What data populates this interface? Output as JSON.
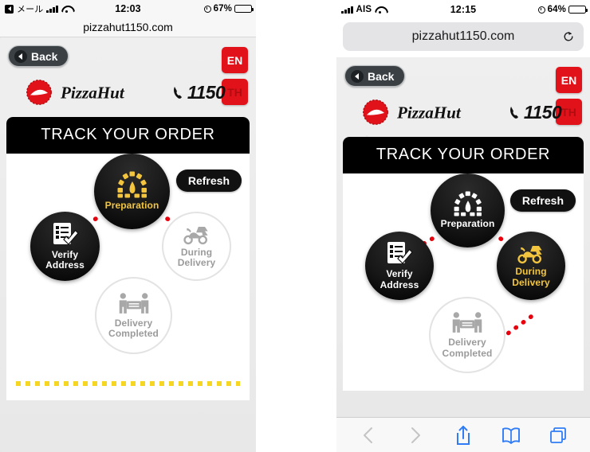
{
  "left_phone": {
    "status_bar": {
      "back_app": "メール",
      "carrier": "",
      "time": "12:03",
      "battery_pct": "67%",
      "signal_icon": "signal-bars-icon",
      "wifi_icon": "wifi-icon",
      "alarm_icon": "alarm-clock-icon",
      "battery_icon": "battery-icon"
    },
    "url": "pizzahut1150.com",
    "back_label": "Back",
    "lang_en": "EN",
    "lang_th": "TH",
    "brand_name": "PizzaHut",
    "phone_number": "1150",
    "track_title": "TRACK YOUR ORDER",
    "refresh_label": "Refresh",
    "steps": [
      {
        "id": "preparation",
        "label_line1": "Preparation",
        "label_line2": "",
        "state": "active-gold",
        "icon": "pizza-oven-icon"
      },
      {
        "id": "verify-address",
        "label_line1": "Verify",
        "label_line2": "Address",
        "state": "active-white",
        "icon": "checklist-icon"
      },
      {
        "id": "during-delivery",
        "label_line1": "During",
        "label_line2": "Delivery",
        "state": "idle",
        "icon": "scooter-icon"
      },
      {
        "id": "delivery-completed",
        "label_line1": "Delivery",
        "label_line2": "Completed",
        "state": "idle",
        "icon": "handover-icon"
      }
    ]
  },
  "right_phone": {
    "status_bar": {
      "back_app": "",
      "carrier": "AIS",
      "time": "12:15",
      "battery_pct": "64%",
      "signal_icon": "signal-bars-icon",
      "wifi_icon": "wifi-icon",
      "alarm_icon": "alarm-clock-icon",
      "battery_icon": "battery-icon"
    },
    "url": "pizzahut1150.com",
    "reload_icon": "reload-icon",
    "back_label": "Back",
    "lang_en": "EN",
    "lang_th": "TH",
    "brand_name": "PizzaHut",
    "phone_number": "1150",
    "track_title": "TRACK YOUR ORDER",
    "refresh_label": "Refresh",
    "steps": [
      {
        "id": "preparation",
        "label_line1": "Preparation",
        "label_line2": "",
        "state": "active-white",
        "icon": "pizza-oven-icon"
      },
      {
        "id": "verify-address",
        "label_line1": "Verify",
        "label_line2": "Address",
        "state": "active-white",
        "icon": "checklist-icon"
      },
      {
        "id": "during-delivery",
        "label_line1": "During",
        "label_line2": "Delivery",
        "state": "active-gold",
        "icon": "scooter-icon"
      },
      {
        "id": "delivery-completed",
        "label_line1": "Delivery",
        "label_line2": "Completed",
        "state": "idle",
        "icon": "handover-icon"
      }
    ],
    "toolbar": [
      {
        "id": "nav-back",
        "icon": "chevron-left-icon",
        "enabled": false
      },
      {
        "id": "nav-forward",
        "icon": "chevron-right-icon",
        "enabled": false
      },
      {
        "id": "share",
        "icon": "share-icon",
        "enabled": true
      },
      {
        "id": "bookmarks",
        "icon": "book-icon",
        "enabled": true
      },
      {
        "id": "tabs",
        "icon": "tabs-icon",
        "enabled": true
      }
    ]
  },
  "colors": {
    "brand_red": "#e1121a",
    "accent_gold": "#f3c53f",
    "connector_red": "#e8000d",
    "dash_yellow": "#f5d623",
    "idle_grey": "#9b9b9b",
    "safari_blue": "#2f7cf6"
  }
}
